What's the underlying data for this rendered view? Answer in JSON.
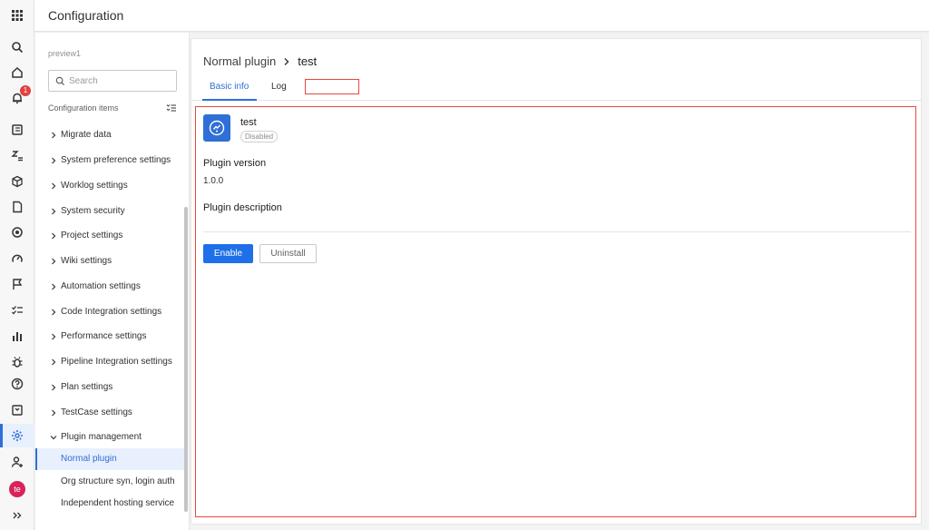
{
  "header": {
    "title": "Configuration"
  },
  "rail": {
    "notification_count": "1",
    "avatar_initials": "te"
  },
  "sidebar": {
    "project_name": "preview1",
    "search": {
      "placeholder": "Search",
      "value": ""
    },
    "section_label": "Configuration items",
    "items": [
      {
        "label": "Migrate data"
      },
      {
        "label": "System preference settings"
      },
      {
        "label": "Worklog settings"
      },
      {
        "label": "System security"
      },
      {
        "label": "Project settings"
      },
      {
        "label": "Wiki settings"
      },
      {
        "label": "Automation settings"
      },
      {
        "label": "Code Integration settings"
      },
      {
        "label": "Performance settings"
      },
      {
        "label": "Pipeline Integration settings"
      },
      {
        "label": "Plan settings"
      },
      {
        "label": "TestCase settings"
      },
      {
        "label": "Plugin management"
      }
    ],
    "plugin_subitems": [
      {
        "label": "Normal plugin"
      },
      {
        "label": "Org structure syn, login auth"
      },
      {
        "label": "Independent hosting service"
      }
    ]
  },
  "main": {
    "breadcrumb": {
      "parent": "Normal plugin",
      "current": "test"
    },
    "tabs": [
      {
        "label": "Basic info"
      },
      {
        "label": "Log"
      }
    ],
    "plugin": {
      "name": "test",
      "status": "Disabled",
      "version_label": "Plugin version",
      "version": "1.0.0",
      "description_label": "Plugin description"
    },
    "actions": {
      "enable": "Enable",
      "uninstall": "Uninstall"
    }
  },
  "colors": {
    "accent": "#2f6fd6",
    "primary_button": "#1e6fe8",
    "highlight_border": "#e8483a",
    "badge": "#e0423f",
    "avatar": "#d8245a"
  }
}
